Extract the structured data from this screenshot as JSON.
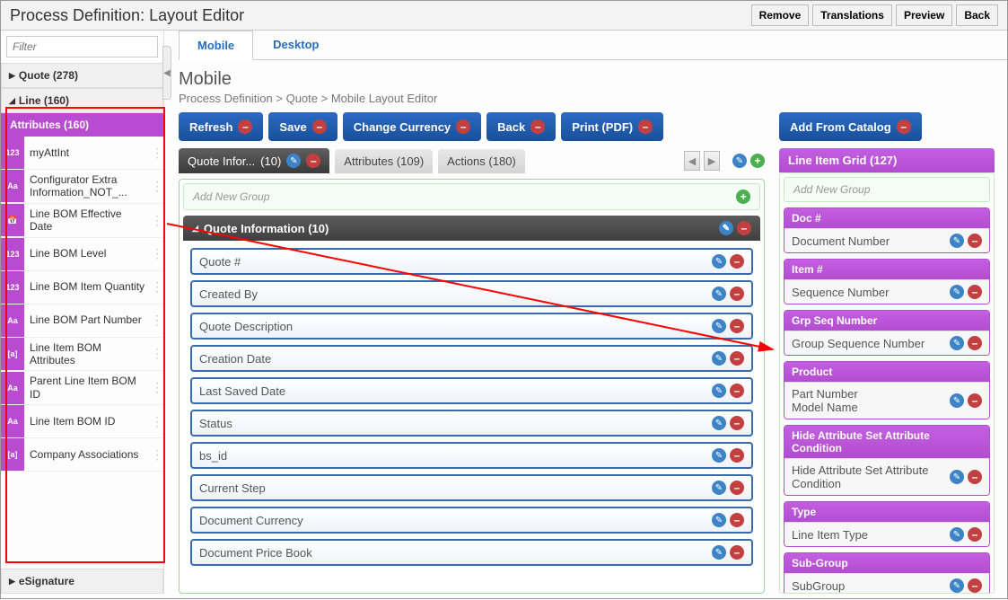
{
  "title": "Process Definition: Layout Editor",
  "top_buttons": [
    "Remove",
    "Translations",
    "Preview",
    "Back"
  ],
  "filter_placeholder": "Filter",
  "tree": {
    "quote_label": "Quote (278)",
    "line_label": "Line (160)",
    "attributes_label": "Attributes (160)",
    "esignature_label": "eSignature"
  },
  "attributes": [
    {
      "icon": "123",
      "label": "myAttInt"
    },
    {
      "icon": "Aa",
      "label": "Configurator Extra Information_NOT_..."
    },
    {
      "icon": "📅",
      "label": "Line BOM Effective Date"
    },
    {
      "icon": "123",
      "label": "Line BOM Level"
    },
    {
      "icon": "123",
      "label": "Line BOM Item Quantity"
    },
    {
      "icon": "Aa",
      "label": "Line BOM Part Number"
    },
    {
      "icon": "[a]",
      "label": "Line Item BOM Attributes"
    },
    {
      "icon": "Aa",
      "label": "Parent Line Item BOM ID"
    },
    {
      "icon": "Aa",
      "label": "Line Item BOM ID"
    },
    {
      "icon": "[a]",
      "label": "Company Associations"
    }
  ],
  "tabs": {
    "mobile": "Mobile",
    "desktop": "Desktop"
  },
  "page_heading": "Mobile",
  "breadcrumb": "Process Definition > Quote > Mobile Layout Editor",
  "actions": [
    "Refresh",
    "Save",
    "Change Currency",
    "Back",
    "Print (PDF)"
  ],
  "side_action": "Add From Catalog",
  "tabpills": {
    "quote_info": "Quote Infor...",
    "quote_info_count": "(10)",
    "attributes": "Attributes (109)",
    "actions": "Actions (180)"
  },
  "add_new_group": "Add New Group",
  "section_title": "Quote Information (10)",
  "fields": [
    "Quote #",
    "Created By",
    "Quote Description",
    "Creation Date",
    "Last Saved Date",
    "Status",
    "bs_id",
    "Current Step",
    "Document Currency",
    "Document Price Book"
  ],
  "grid_title": "Line Item Grid (127)",
  "grid_items": [
    {
      "hdr": "Doc #",
      "body": "Document Number"
    },
    {
      "hdr": "Item #",
      "body": "Sequence Number"
    },
    {
      "hdr": "Grp Seq Number",
      "body": "Group Sequence Number"
    },
    {
      "hdr": "Product",
      "body": "Part Number\nModel Name"
    },
    {
      "hdr": "Hide Attribute Set Attribute Condition",
      "body": "Hide Attribute Set Attribute Condition"
    },
    {
      "hdr": "Type",
      "body": "Line Item Type"
    },
    {
      "hdr": "Sub-Group",
      "body": "SubGroup"
    }
  ]
}
